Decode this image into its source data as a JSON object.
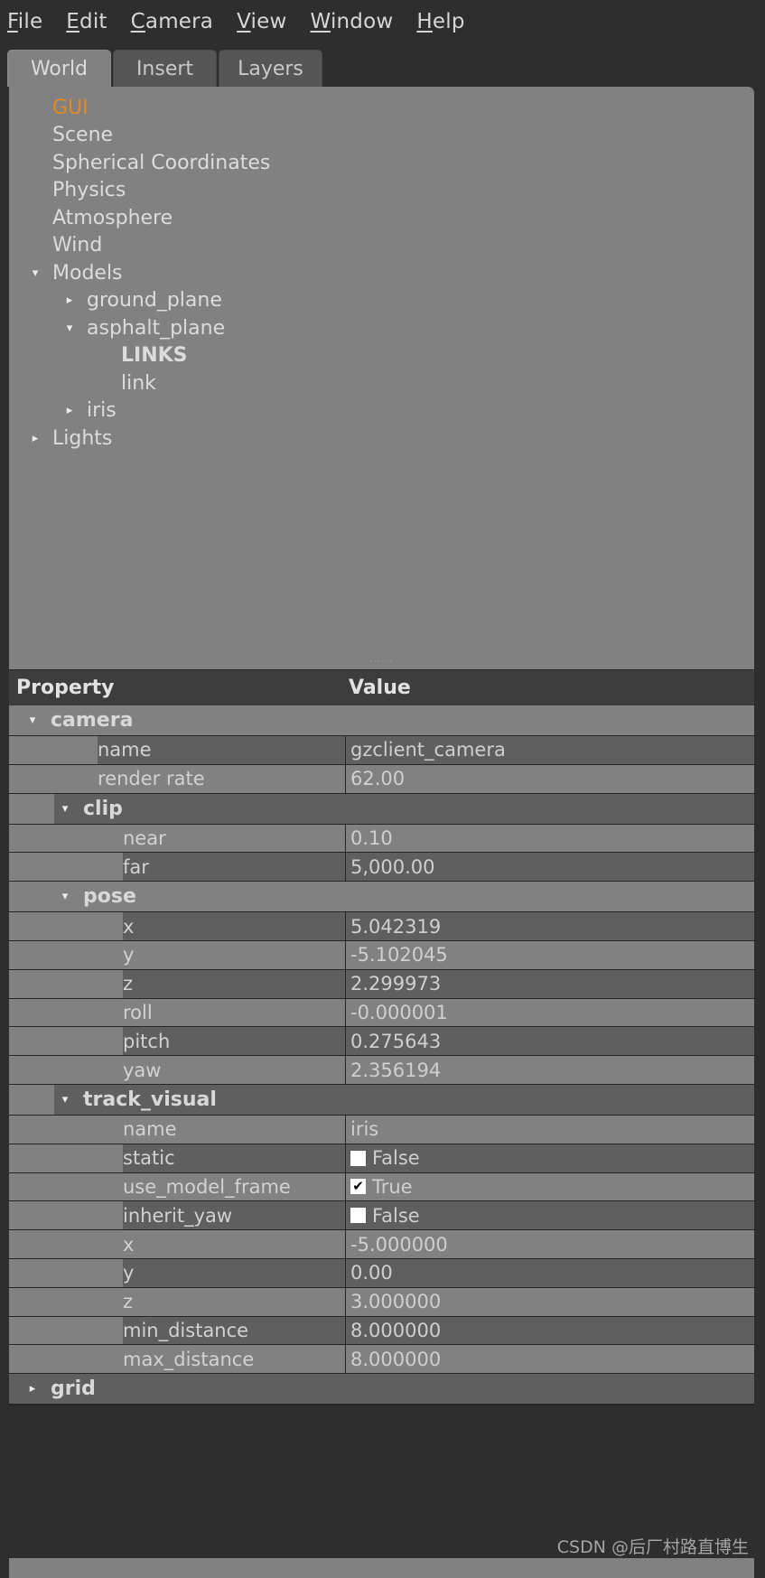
{
  "menu": {
    "items": [
      {
        "label": "File",
        "mnemonic": "F"
      },
      {
        "label": "Edit",
        "mnemonic": "E"
      },
      {
        "label": "Camera",
        "mnemonic": "C"
      },
      {
        "label": "View",
        "mnemonic": "V"
      },
      {
        "label": "Window",
        "mnemonic": "W"
      },
      {
        "label": "Help",
        "mnemonic": "H"
      }
    ]
  },
  "tabs": [
    {
      "label": "World",
      "active": true
    },
    {
      "label": "Insert",
      "active": false
    },
    {
      "label": "Layers",
      "active": false
    }
  ],
  "tree": {
    "items": [
      {
        "label": "GUI",
        "indent": 0,
        "arrow": "",
        "style": "highlight"
      },
      {
        "label": "Scene",
        "indent": 0,
        "arrow": "",
        "style": ""
      },
      {
        "label": "Spherical Coordinates",
        "indent": 0,
        "arrow": "",
        "style": ""
      },
      {
        "label": "Physics",
        "indent": 0,
        "arrow": "",
        "style": ""
      },
      {
        "label": "Atmosphere",
        "indent": 0,
        "arrow": "",
        "style": ""
      },
      {
        "label": "Wind",
        "indent": 0,
        "arrow": "",
        "style": ""
      },
      {
        "label": "Models",
        "indent": 0,
        "arrow": "expanded",
        "style": ""
      },
      {
        "label": "ground_plane",
        "indent": 1,
        "arrow": "collapsed",
        "style": ""
      },
      {
        "label": "asphalt_plane",
        "indent": 1,
        "arrow": "expanded",
        "style": ""
      },
      {
        "label": "LINKS",
        "indent": 2,
        "arrow": "",
        "style": "bold"
      },
      {
        "label": "link",
        "indent": 2,
        "arrow": "",
        "style": ""
      },
      {
        "label": "iris",
        "indent": 1,
        "arrow": "collapsed",
        "style": ""
      },
      {
        "label": "Lights",
        "indent": 0,
        "arrow": "collapsed",
        "style": ""
      }
    ]
  },
  "splitter": {
    "grip": "······"
  },
  "property_table": {
    "headers": {
      "property": "Property",
      "value": "Value"
    },
    "rows": [
      {
        "kind": "group",
        "label": "camera",
        "indent": 0,
        "arrow": "expanded",
        "shade": "light"
      },
      {
        "kind": "prop",
        "label": "name",
        "indent": 1,
        "value": "gzclient_camera",
        "shade": "dark"
      },
      {
        "kind": "prop",
        "label": "render rate",
        "indent": 1,
        "value": "62.00",
        "shade": "light"
      },
      {
        "kind": "group",
        "label": "clip",
        "indent": 1,
        "arrow": "expanded",
        "shade": "dark"
      },
      {
        "kind": "prop",
        "label": "near",
        "indent": 2,
        "value": "0.10",
        "shade": "light"
      },
      {
        "kind": "prop",
        "label": "far",
        "indent": 2,
        "value": "5,000.00",
        "shade": "dark"
      },
      {
        "kind": "group",
        "label": "pose",
        "indent": 1,
        "arrow": "expanded",
        "shade": "light"
      },
      {
        "kind": "prop",
        "label": "x",
        "indent": 2,
        "value": "5.042319",
        "shade": "dark"
      },
      {
        "kind": "prop",
        "label": "y",
        "indent": 2,
        "value": "-5.102045",
        "shade": "light"
      },
      {
        "kind": "prop",
        "label": "z",
        "indent": 2,
        "value": "2.299973",
        "shade": "dark"
      },
      {
        "kind": "prop",
        "label": "roll",
        "indent": 2,
        "value": "-0.000001",
        "shade": "light"
      },
      {
        "kind": "prop",
        "label": "pitch",
        "indent": 2,
        "value": "0.275643",
        "shade": "dark"
      },
      {
        "kind": "prop",
        "label": "yaw",
        "indent": 2,
        "value": "2.356194",
        "shade": "light"
      },
      {
        "kind": "group",
        "label": "track_visual",
        "indent": 1,
        "arrow": "expanded",
        "shade": "dark"
      },
      {
        "kind": "prop",
        "label": "name",
        "indent": 2,
        "value": "iris",
        "shade": "light"
      },
      {
        "kind": "prop",
        "label": "static",
        "indent": 2,
        "value": "False",
        "checkbox": "unchecked",
        "shade": "dark"
      },
      {
        "kind": "prop",
        "label": "use_model_frame",
        "indent": 2,
        "value": "True",
        "checkbox": "checked",
        "shade": "light"
      },
      {
        "kind": "prop",
        "label": "inherit_yaw",
        "indent": 2,
        "value": "False",
        "checkbox": "unchecked",
        "shade": "dark"
      },
      {
        "kind": "prop",
        "label": "x",
        "indent": 2,
        "value": "-5.000000",
        "shade": "light"
      },
      {
        "kind": "prop",
        "label": "y",
        "indent": 2,
        "value": "0.00",
        "shade": "dark"
      },
      {
        "kind": "prop",
        "label": "z",
        "indent": 2,
        "value": "3.000000",
        "shade": "light"
      },
      {
        "kind": "prop",
        "label": "min_distance",
        "indent": 2,
        "value": "8.000000",
        "shade": "dark"
      },
      {
        "kind": "prop",
        "label": "max_distance",
        "indent": 2,
        "value": "8.000000",
        "shade": "light"
      },
      {
        "kind": "group",
        "label": "grid",
        "indent": 0,
        "arrow": "collapsed",
        "shade": "dark"
      }
    ]
  },
  "watermark": {
    "text": "CSDN @后厂村路直博生"
  },
  "colors": {
    "window_bg": "#2e2e2e",
    "panel_bg": "#818181",
    "row_dark": "#5f5f5f",
    "header_bg": "#3d3d3d",
    "accent_orange": "#e08a28",
    "text": "#dcdcdc",
    "grid_line": "#262626"
  },
  "icons": {
    "expanded": "▾",
    "collapsed": "▸",
    "checked": "✔"
  }
}
